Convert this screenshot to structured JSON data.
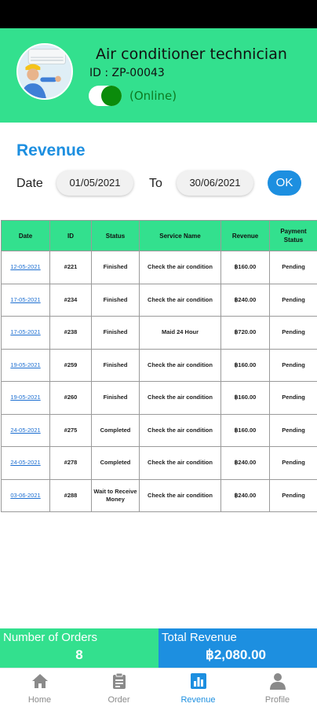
{
  "header": {
    "title": "Air conditioner technician",
    "id_text": "ID : ZP-00043",
    "status_text": "(Online)"
  },
  "revenue": {
    "title": "Revenue",
    "date_label": "Date",
    "date_from": "01/05/2021",
    "to_label": "To",
    "date_to": "30/06/2021",
    "ok_label": "OK"
  },
  "table": {
    "headers": [
      "Date",
      "ID",
      "Status",
      "Service Name",
      "Revenue",
      "Payment Status"
    ],
    "rows": [
      {
        "date": "12-05-2021",
        "id": "#221",
        "status": "Finished",
        "service": "Check the air condition",
        "revenue": "฿160.00",
        "payment": "Pending"
      },
      {
        "date": "17-05-2021",
        "id": "#234",
        "status": "Finished",
        "service": "Check the air condition",
        "revenue": "฿240.00",
        "payment": "Pending"
      },
      {
        "date": "17-05-2021",
        "id": "#238",
        "status": "Finished",
        "service": "Maid 24 Hour",
        "revenue": "฿720.00",
        "payment": "Pending"
      },
      {
        "date": "19-05-2021",
        "id": "#259",
        "status": "Finished",
        "service": "Check the air condition",
        "revenue": "฿160.00",
        "payment": "Pending"
      },
      {
        "date": "19-05-2021",
        "id": "#260",
        "status": "Finished",
        "service": "Check the air condition",
        "revenue": "฿160.00",
        "payment": "Pending"
      },
      {
        "date": "24-05-2021",
        "id": "#275",
        "status": "Completed",
        "service": "Check the air condition",
        "revenue": "฿160.00",
        "payment": "Pending"
      },
      {
        "date": "24-05-2021",
        "id": "#278",
        "status": "Completed",
        "service": "Check the air condition",
        "revenue": "฿240.00",
        "payment": "Pending"
      },
      {
        "date": "03-06-2021",
        "id": "#288",
        "status": "Wait to Receive Money",
        "service": "Check the air condition",
        "revenue": "฿240.00",
        "payment": "Pending"
      }
    ]
  },
  "summary": {
    "orders_label": "Number of Orders",
    "orders_value": "8",
    "revenue_label": "Total Revenue",
    "revenue_value": "฿2,080.00"
  },
  "nav": {
    "items": [
      {
        "label": "Home",
        "icon": "home-icon"
      },
      {
        "label": "Order",
        "icon": "clipboard-icon"
      },
      {
        "label": "Revenue",
        "icon": "bar-chart-icon",
        "active": true
      },
      {
        "label": "Profile",
        "icon": "person-icon"
      }
    ]
  },
  "colors": {
    "brand_green": "#33e08e",
    "brand_blue": "#1d8fe0",
    "online_green": "#0b8b0b"
  }
}
